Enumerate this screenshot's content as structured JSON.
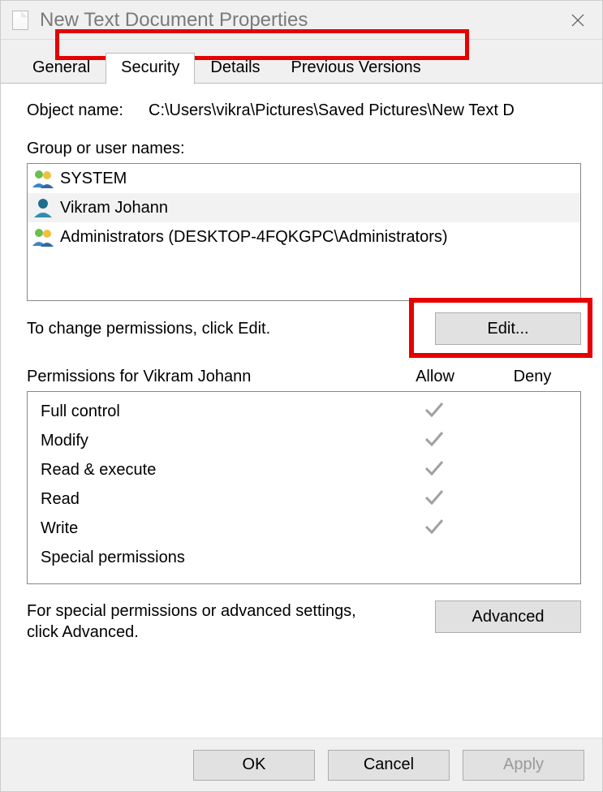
{
  "window": {
    "title": "New Text Document Properties"
  },
  "tabs": {
    "general": "General",
    "security": "Security",
    "details": "Details",
    "previous": "Previous Versions"
  },
  "object": {
    "label": "Object name:",
    "value": "C:\\Users\\vikra\\Pictures\\Saved Pictures\\New Text D"
  },
  "group": {
    "label": "Group or user names:",
    "items": [
      {
        "name": "SYSTEM"
      },
      {
        "name": "Vikram Johann"
      },
      {
        "name": "Administrators (DESKTOP-4FQKGPC\\Administrators)"
      }
    ]
  },
  "edit": {
    "text": "To change permissions, click Edit.",
    "button": "Edit..."
  },
  "perm": {
    "header": "Permissions for Vikram Johann",
    "allow": "Allow",
    "deny": "Deny",
    "rows": [
      {
        "name": "Full control",
        "allow": true
      },
      {
        "name": "Modify",
        "allow": true
      },
      {
        "name": "Read & execute",
        "allow": true
      },
      {
        "name": "Read",
        "allow": true
      },
      {
        "name": "Write",
        "allow": true
      },
      {
        "name": "Special permissions",
        "allow": false
      }
    ]
  },
  "advanced": {
    "text": "For special permissions or advanced settings, click Advanced.",
    "button": "Advanced"
  },
  "footer": {
    "ok": "OK",
    "cancel": "Cancel",
    "apply": "Apply"
  }
}
